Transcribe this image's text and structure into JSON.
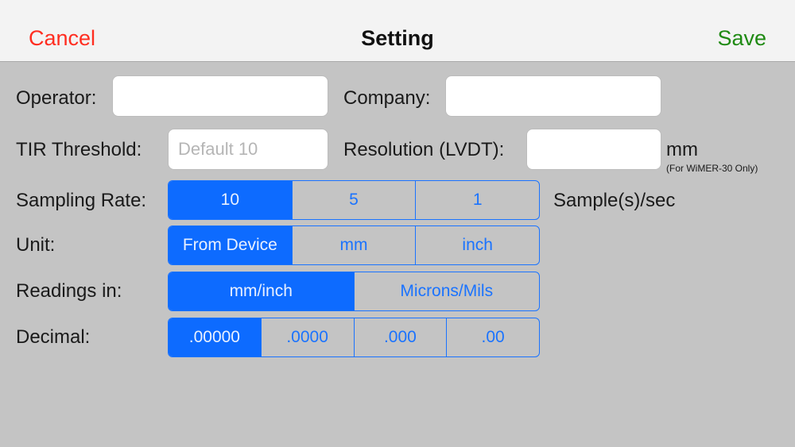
{
  "navbar": {
    "cancel_label": "Cancel",
    "title": "Setting",
    "save_label": "Save",
    "cancel_color": "#ff2d20",
    "save_color": "#1f8a13"
  },
  "form": {
    "operator_label": "Operator:",
    "operator_value": "",
    "company_label": "Company:",
    "company_value": "",
    "tir_threshold_label": "TIR Threshold:",
    "tir_threshold_placeholder": "Default 10",
    "resolution_label": "Resolution (LVDT):",
    "resolution_value": "",
    "resolution_unit": "mm",
    "resolution_note": "(For WiMER-30 Only)",
    "sampling_rate_label": "Sampling Rate:",
    "sampling_rate_options": [
      "10",
      "5",
      "1"
    ],
    "sampling_rate_selected": "10",
    "sampling_rate_unit": "Sample(s)/sec",
    "unit_label": "Unit:",
    "unit_options": [
      "From Device",
      "mm",
      "inch"
    ],
    "unit_selected": "From Device",
    "readings_label": "Readings in:",
    "readings_options": [
      "mm/inch",
      "Microns/Mils"
    ],
    "readings_selected": "mm/inch",
    "decimal_label": "Decimal:",
    "decimal_options": [
      ".00000",
      ".0000",
      ".000",
      ".00"
    ],
    "decimal_selected": ".00000"
  },
  "colors": {
    "accent": "#1a73ff",
    "selected_fill": "#0d6bff",
    "background": "#c4c4c4",
    "navbar_background": "#f3f3f3"
  }
}
